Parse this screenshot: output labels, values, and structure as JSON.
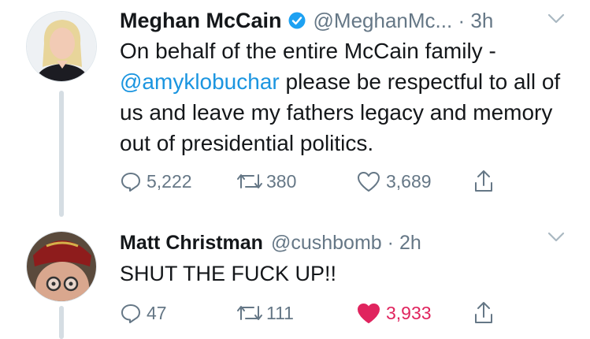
{
  "tweets": [
    {
      "author_name": "Meghan McCain",
      "verified": true,
      "handle": "@MeghanMc...",
      "separator": "·",
      "time": "3h",
      "text_line1": "On behalf of the entire McCain family -",
      "mention": "@amyklobuchar",
      "text_after_mention": " please be respectful to all of us and leave my fathers legacy and memory out of presidential politics.",
      "replies": "5,222",
      "retweets": "380",
      "likes": "3,689",
      "liked": false
    },
    {
      "author_name": "Matt Christman",
      "verified": false,
      "handle": "@cushbomb",
      "separator": "·",
      "time": "2h",
      "text": "SHUT THE FUCK UP!!",
      "replies": "47",
      "retweets": "111",
      "likes": "3,933",
      "liked": true
    }
  ],
  "icons": {
    "reply": "reply-icon",
    "retweet": "retweet-icon",
    "like": "heart-icon",
    "share": "share-icon",
    "verified": "verified-badge-icon",
    "menu": "chevron-down-icon"
  },
  "colors": {
    "text": "#14171a",
    "secondary": "#657786",
    "link": "#1b95e0",
    "like": "#e0245e",
    "verified": "#1da1f2"
  }
}
